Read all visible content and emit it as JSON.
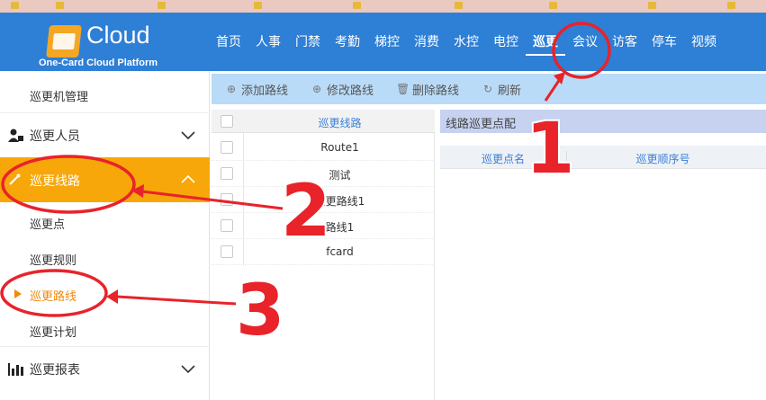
{
  "app": {
    "logo_text": "Cloud",
    "logo_sub": "One-Card Cloud Platform"
  },
  "nav": {
    "items": [
      "首页",
      "人事",
      "门禁",
      "考勤",
      "梯控",
      "消费",
      "水控",
      "电控",
      "巡更",
      "会议",
      "访客",
      "停车",
      "视频"
    ],
    "active": "巡更"
  },
  "sidebar": {
    "items": [
      {
        "label": "巡更机管理",
        "type": "sub"
      },
      {
        "label": "巡更人员",
        "type": "group"
      },
      {
        "label": "巡更线路",
        "type": "group",
        "active": true
      },
      {
        "label": "巡更点",
        "type": "sub"
      },
      {
        "label": "巡更规则",
        "type": "sub"
      },
      {
        "label": "巡更路线",
        "type": "sub",
        "current": true
      },
      {
        "label": "巡更计划",
        "type": "sub"
      },
      {
        "label": "巡更报表",
        "type": "group"
      }
    ]
  },
  "toolbar": {
    "add_label": "添加路线",
    "edit_label": "修改路线",
    "delete_label": "删除路线",
    "refresh_label": "刷新"
  },
  "route_table": {
    "header": "巡更线路",
    "rows": [
      "Route1",
      "测试",
      "巡更路线1",
      "路线1",
      "fcard"
    ]
  },
  "route_points": {
    "title": "线路巡更点配",
    "columns": [
      "巡更点名",
      "巡更顺序号"
    ]
  },
  "annotations": {
    "labels": [
      "1",
      "2",
      "3"
    ],
    "color": "#e8232a"
  },
  "colors": {
    "header_bg": "#2e7fd6",
    "accent_orange": "#f7a70a",
    "toolbar_bg": "#b9dbf8"
  }
}
